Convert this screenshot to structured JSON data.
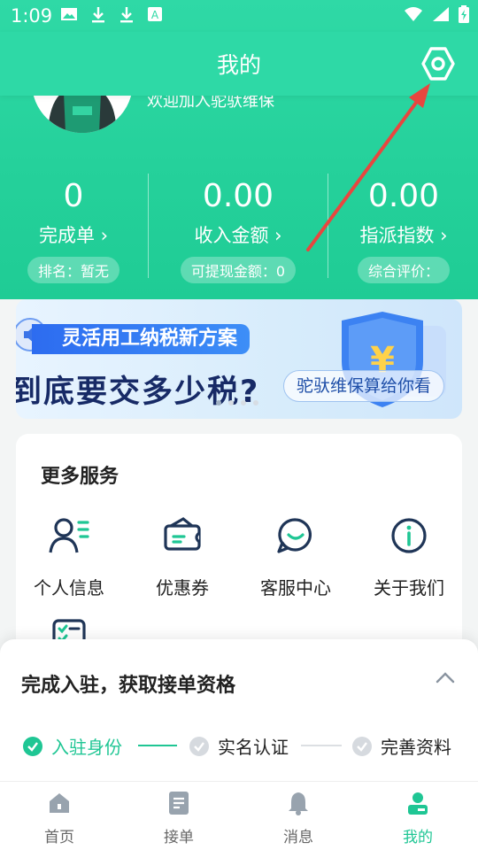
{
  "status_bar": {
    "time": "1:09"
  },
  "header": {
    "title": "我的"
  },
  "profile": {
    "welcome": "欢迎加入驼驮维保"
  },
  "stats": [
    {
      "value": "0",
      "label": "完成单 ›",
      "sub": "排名：暂无"
    },
    {
      "value": "0.00",
      "label": "收入金额 ›",
      "sub": "可提现金额：0"
    },
    {
      "value": "0.00",
      "label": "指派指数 ›",
      "sub": "综合评价："
    }
  ],
  "banner": {
    "tag": "灵活用工纳税新方案",
    "headline": "到底要交多少税?",
    "pill": "驼驮维保算给你看",
    "active_dot": 0,
    "dot_count": 4
  },
  "services": {
    "title": "更多服务",
    "items": [
      {
        "label": "个人信息",
        "icon": "person-list-icon"
      },
      {
        "label": "优惠券",
        "icon": "coupon-icon"
      },
      {
        "label": "客服中心",
        "icon": "chat-smile-icon"
      },
      {
        "label": "关于我们",
        "icon": "info-icon"
      }
    ]
  },
  "onboarding": {
    "title": "完成入驻，获取接单资格",
    "steps": [
      {
        "label": "入驻身份",
        "done": true
      },
      {
        "label": "实名认证",
        "done": false
      },
      {
        "label": "完善资料",
        "done": false
      }
    ]
  },
  "tabs": [
    {
      "label": "首页",
      "active": false
    },
    {
      "label": "接单",
      "active": false
    },
    {
      "label": "消息",
      "active": false
    },
    {
      "label": "我的",
      "active": true
    }
  ],
  "colors": {
    "brand": "#25d19b",
    "accent_red": "#e8463f",
    "banner_blue": "#2d6cf0"
  }
}
